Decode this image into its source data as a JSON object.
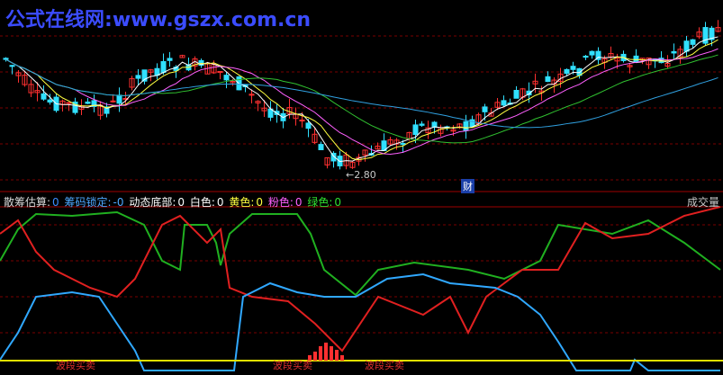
{
  "watermark": {
    "cn": "公式在线网",
    "url": ":www.gszx.com.cn"
  },
  "main_panel": {
    "low_price_label": "2.80",
    "low_price_arrow": "←",
    "badge": "财"
  },
  "indicator_legend": [
    {
      "name": "散筹估算:",
      "value": "0",
      "color": "#d8d8d8",
      "value_color": "#3c8cff"
    },
    {
      "name": "筹码锁定:",
      "value": "-0",
      "color": "#4ea8ff",
      "value_color": "#4ea8ff"
    },
    {
      "name": "动态底部:",
      "value": "0",
      "color": "#ffffff",
      "value_color": "#ffffff"
    },
    {
      "name": "白色:",
      "value": "0",
      "color": "#ffffff",
      "value_color": "#ffffff"
    },
    {
      "name": "黄色:",
      "value": "0",
      "color": "#ffff40",
      "value_color": "#ffff40"
    },
    {
      "name": "粉色:",
      "value": "0",
      "color": "#ff60ff",
      "value_color": "#ff60ff"
    },
    {
      "name": "绿色:",
      "value": "0",
      "color": "#30e030",
      "value_color": "#30e030"
    }
  ],
  "volume_label": "成交量",
  "wave_labels": [
    "波段买卖",
    "波段买卖",
    "波段买卖"
  ],
  "colors": {
    "bull": "#ff3030",
    "bear": "#30e0ff",
    "ma_white": "#ffffff",
    "ma_yellow": "#ffff40",
    "ma_pink": "#ff60ff",
    "ma_green": "#30c030",
    "ma_cyan": "#30a0e0",
    "ind_red": "#e02020",
    "ind_green": "#20b020",
    "ind_blue": "#30a8ff",
    "grid": "#7a0000"
  }
}
